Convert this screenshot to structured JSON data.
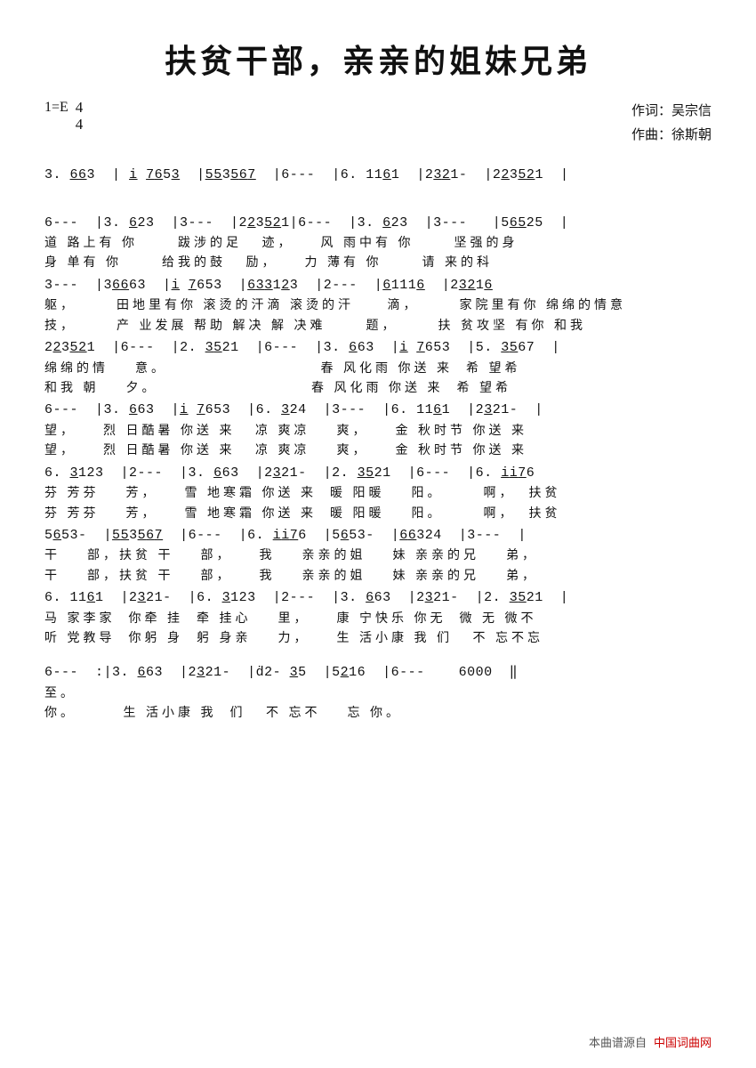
{
  "title": "扶贫干部，亲亲的姐妹兄弟",
  "key": "1=E",
  "time_num": "4",
  "time_den": "4",
  "author": {
    "lyrics": "作词：吴宗信",
    "music": "作曲：徐斯朝"
  },
  "footer": {
    "left": "本曲谱源自",
    "right": "中国词曲网"
  },
  "notation_lines": [
    "3. <u>6</u><u>6</u>3  | <u>i</u> <u>7</u><u>6</u>5<u>3</u>  |<u>5</u><u>5</u>3<u>5</u><u>6</u><u>7</u>  |6---  |6. 11<u>6</u>1  |2<u>3</u><u>2</u>1-  |2<u>2</u>3<u>5</u><u>2</u>1  |",
    "",
    "6---  |3. <u>6</u>23  |3---  |2<u>2</u>3<u>5</u><u>2</u>1|6---  |3. <u>6</u>23  |3---   |5<u>6</u><u>5</u>25  |",
    "道 路上有 你      跋涉的足    迹，    风 雨中有 你      坚强的身",
    "身 单有 你      给我的鼓    励，    力 薄有 你      请 来的科",
    "3---  |3<u>6</u><u>6</u>63  |<u>i</u> <u>7</u>653  |<u>6</u><u>3</u><u>3</u>1<u>2</u>3  |2---  |<u>6</u>111<u>6</u>  |2<u>3</u><u>2</u>1<u>6</u>",
    "躯，      田地里有你 滚烫的汗滴 滚烫的汗     滴，      家院里有你 绵绵的情意",
    "技，      产 业发展 帮助 解决 解 决难      题，      扶 贫攻坚 有你 和我",
    "2<u>2</u>3<u>5</u><u>2</u>1  |6---  |2. <u>3</u><u>5</u>21  |6---  |3. <u>6</u>63  |<u>i</u> <u>7</u>653  |5. <u>3</u><u>5</u>67  |",
    "绵绵的情    意。                       春 风化雨 你送 来  希 望希",
    "和我 朝    夕。                       春 风化雨 你送 来  希 望希",
    "6---  |3. <u>6</u>63  |<u>i</u> <u>7</u>653  |6. <u>3</u>24  |3---  |6. 11<u>6</u>1  |2<u>3</u>21-  |",
    "望，    烈 日酷暑 你送 来   凉 爽凉    爽，    金 秋时节 你送 来",
    "望，    烈 日酷暑 你送 来   凉 爽凉    爽，    金 秋时节 你送 来",
    "6. <u>3</u>123  |2---  |3. <u>6</u>63  |2<u>3</u>21-  |2. <u>3</u><u>5</u>21  |6---  |6. <u>i</u><u>i</u><u>7</u>6",
    "芬 芳芬    芳，    雪 地寒霜 你送 来  暖 阳暖    阳。      啊，  扶贫",
    "芬 芳芬    芳，    雪 地寒霜 你送 来  暖 阳暖    阳。      啊，  扶贫",
    "5<u>6</u>53-  |<u>5</u><u>5</u>3<u>5</u><u>6</u><u>7</u>  |6---  |6. <u>i</u><u>i</u><u>7</u>6  |5<u>6</u>53-  |<u>6</u><u>6</u>324  |3---  |",
    "干    部，扶贫 干    部，    我    亲亲的姐    妹 亲亲的兄    弟，",
    "干    部，扶贫 干    部，    我    亲亲的姐    妹 亲亲的兄    弟，",
    "6. 11<u>6</u>1  |2<u>3</u>21-  |6. <u>3</u>123  |2---  |3. <u>6</u>63  |2<u>3</u>21-  |2. <u>3</u><u>5</u>21  |",
    "马 家李家  你牵 挂  牵 挂心    里，    康 宁快乐 你无  微 无 微不",
    "听 党教导  你躬 身  躬 身亲    力，    生 活小康 我 们   不 忘不忘",
    "",
    "6---  :|3. <u>6</u>63  |2<u>3</u>21-  |ḋ2- <u>3</u>5  |5<u>2</u>16  |6---    6000  ‖",
    "至。",
    "你。       生 活小康 我  们   不 忘不    忘 你。"
  ]
}
